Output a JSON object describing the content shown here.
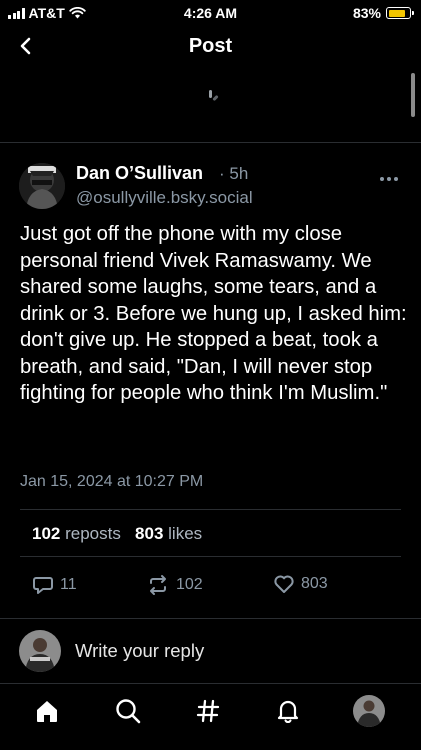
{
  "status_bar": {
    "carrier": "AT&T",
    "time": "4:26 AM",
    "battery_percent_label": "83%",
    "battery_level": 0.83,
    "battery_color": "#f2c500"
  },
  "header": {
    "title": "Post",
    "back_icon": "chevron-left-icon"
  },
  "post": {
    "author_name": "Dan O’Sullivan",
    "age": "· 5h",
    "handle": "@osullyville.bsky.social",
    "avatar_image_text": "Paddy's Policeman",
    "text": "Just got off the phone with my close personal friend Vivek Ramaswamy. We shared some laughs, some tears, and a drink or 3. Before we hung up, I asked him: don't give up. He stopped a beat, took a breath, and said, \"Dan, I will never stop fighting for people who think I'm Muslim.\"",
    "timestamp": "Jan 15, 2024 at 10:27 PM",
    "reposts_count": "102",
    "reposts_label": "reposts",
    "likes_count": "803",
    "likes_label": "likes"
  },
  "actions": {
    "reply_count": "11",
    "repost_count": "102",
    "like_count": "803"
  },
  "reply_box": {
    "placeholder": "Write your reply"
  },
  "tabbar": {
    "items": [
      "home-icon",
      "search-icon",
      "hashtag-icon",
      "notifications-bell-icon",
      "profile-avatar"
    ]
  },
  "colors": {
    "background": "#000000",
    "secondary_text": "#8b98a5",
    "divider": "#2a2d31"
  }
}
